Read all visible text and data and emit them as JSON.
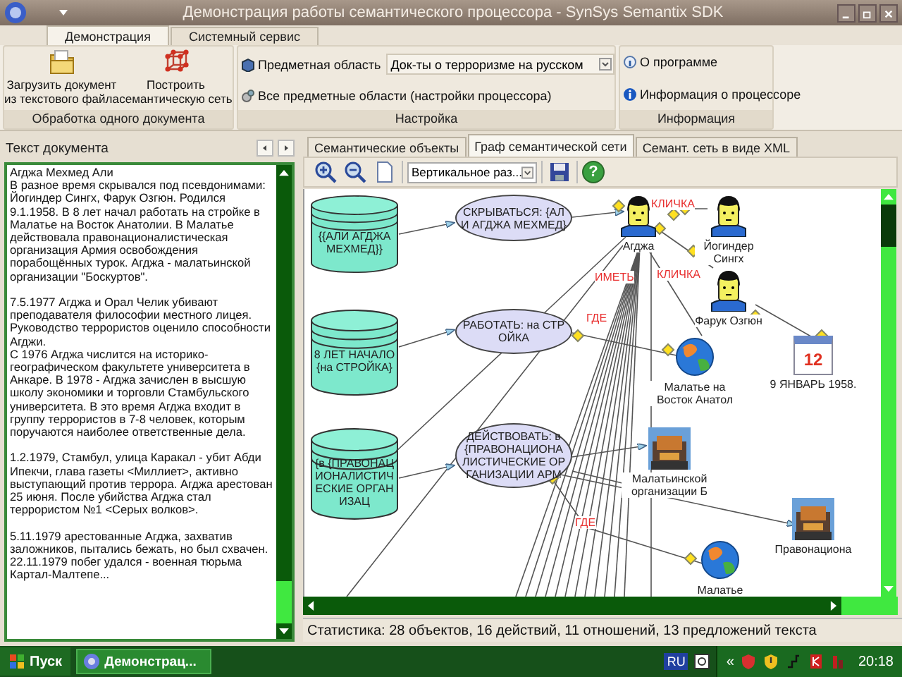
{
  "window": {
    "title": "Демонстрация работы семантического процессора - SynSys Semantix SDK"
  },
  "ribbon_tabs": [
    {
      "label": "Демонстрация",
      "selected": true
    },
    {
      "label": "Системный сервис",
      "selected": false
    }
  ],
  "ribbon_groups": [
    {
      "kind": "buttons",
      "title": "Обработка одного документа",
      "buttons": [
        "Загрузить документ\nиз текстового файла",
        "Построить\nсемантическую сеть"
      ]
    },
    {
      "kind": "settings",
      "title": "Настройка",
      "domain_label": "Предметная область",
      "domain_value": "Док-ты о терроризме на русском",
      "all_domains": "Все предметные области (настройки процессора)"
    },
    {
      "kind": "links",
      "title": "Информация",
      "links": [
        "О программе",
        "Информация о процессоре"
      ]
    }
  ],
  "document_panel": {
    "title": "Текст документа",
    "paragraphs": [
      "Агджа Мехмед Али\nВ разное время скрывался под псевдонимами: Йогиндер Сингх, Фарук Озгюн. Родился 9.1.1958. В 8 лет начал работать  на стройке в Малатье на Восток Анатолии. В Малатье действовала правонационалистическая организация Армия освобождения порабощённых турок. Агджа - малатьинской  организации \"Боскуртов\".",
      "7.5.1977 Агджа и Орал Челик убивают преподавателя философии местного лицея. Руководство террористов оценило способности Агджи.\n С 1976 Агджа числится на историко-географическом факультете университета в Анкаре. В 1978 - Агджа зачислен в высшую школу экономики и торговли Стамбульского университета. В это время Агджа входит в группу террористов в 7-8 человек, которым поручаются наиболее ответственные дела.",
      "1.2.1979, Стамбул, улица Каракал - убит Абди Ипекчи, глава газеты <Миллиет>, активно выступающий против террора. Агджа арестован 25 июня. После убийства  Агджа стал террористом №1 <Серых волков>.",
      "5.11.1979 арестованные Агджа, захватив заложников, пытались бежать, но был схвачен.  22.11.1979 побег удался  - военная тюрьма Картал-Малтепе..."
    ]
  },
  "graph_tabs": [
    {
      "label": "Семантические объекты",
      "selected": false
    },
    {
      "label": "Граф семантической сети",
      "selected": true
    },
    {
      "label": "Семант. сеть в виде XML",
      "selected": false
    }
  ],
  "graph_toolbar": {
    "layout_value": "Вертикальное раз...",
    "help_glyph": "?"
  },
  "graph": {
    "nodes": [
      {
        "kind": "storage",
        "label": "{{АЛИ АГДЖА МЕХМЕД}}"
      },
      {
        "kind": "storage",
        "label": "8 ЛЕТ НАЧАЛО {на СТРОЙКА}"
      },
      {
        "kind": "storage",
        "label": "{в {ПРАВОНАЦИОНАЛИСТИЧЕСКИЕ ОРГАНИЗАЦ"
      },
      {
        "kind": "action",
        "label": "СКРЫВАТЬСЯ: {АЛИ АГДЖА МЕХМЕД}"
      },
      {
        "kind": "action",
        "label": "РАБОТАТЬ: на СТРОЙКА"
      },
      {
        "kind": "action",
        "label": "ДЕЙСТВОВАТЬ: в {ПРАВОНАЦИОНАЛИСТИЧЕСКИЕ ОРГАНИЗАЦИИ АРМ"
      },
      {
        "kind": "person",
        "label": "Агджа"
      },
      {
        "kind": "person",
        "label": "Йогиндер Сингх"
      },
      {
        "kind": "person",
        "label": "Фарук Озгюн"
      },
      {
        "kind": "place",
        "label": "Малатье на Восток Анатол"
      },
      {
        "kind": "date",
        "label": "9 ЯНВАРЬ 1958.",
        "icon_text": "12"
      },
      {
        "kind": "organization",
        "label": "Малатьинской организации Б"
      },
      {
        "kind": "organization",
        "label": "Правонациона"
      },
      {
        "kind": "place",
        "label": "Малатье"
      }
    ],
    "relations": [
      {
        "label": "КЛИЧКА"
      },
      {
        "label": "КЛИЧКА"
      },
      {
        "label": "ИМЕТЬ"
      },
      {
        "label": "ГДЕ"
      },
      {
        "label": "ГДЕ"
      }
    ]
  },
  "status_bar": "Статистика: 28 объектов, 16 действий, 11 отношений, 13 предложений текста",
  "taskbar": {
    "start": "Пуск",
    "task": "Демонстрац...",
    "language": "RU",
    "tray_expand": "«",
    "clock": "20:18"
  }
}
